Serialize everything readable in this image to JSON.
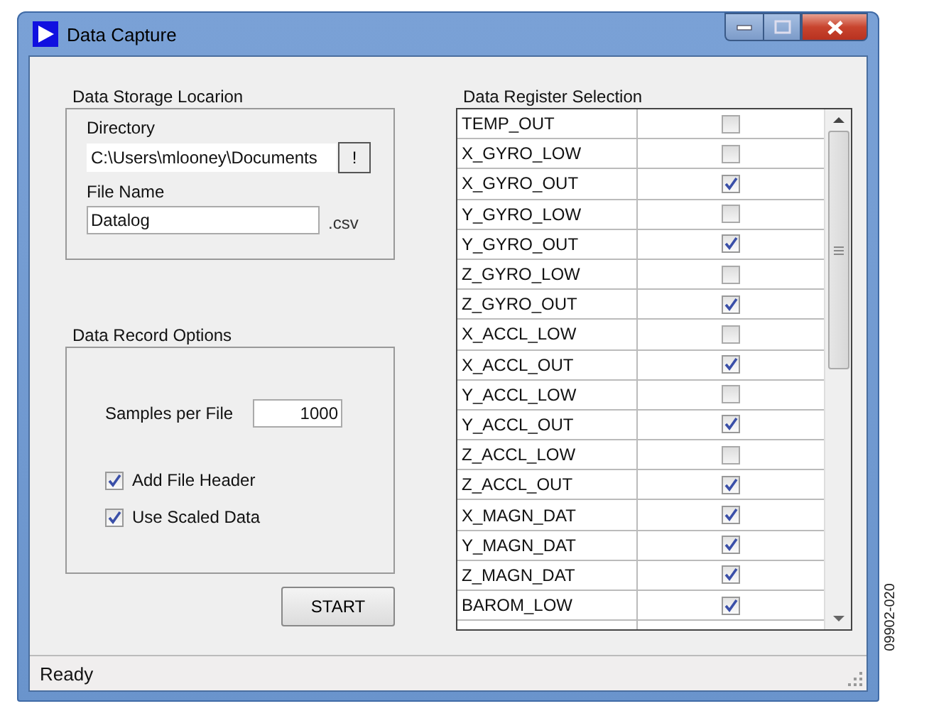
{
  "window": {
    "title": "Data Capture"
  },
  "storage": {
    "title": "Data Storage Locarion",
    "directory_label": "Directory",
    "directory": "C:\\Users\\mlooney\\Documents",
    "browse_button": "!",
    "file_name_label": "File Name",
    "file_name": "Datalog",
    "extension": ".csv"
  },
  "record_options": {
    "title": "Data Record Options",
    "samples_label": "Samples per File",
    "samples": "1000",
    "checkboxes": [
      {
        "label": "Add File Header",
        "checked": true
      },
      {
        "label": "Use Scaled Data",
        "checked": true
      }
    ]
  },
  "start_button": "START",
  "registers": {
    "title": "Data Register Selection",
    "rows": [
      {
        "name": "TEMP_OUT",
        "checked": false
      },
      {
        "name": "X_GYRO_LOW",
        "checked": false
      },
      {
        "name": "X_GYRO_OUT",
        "checked": true
      },
      {
        "name": "Y_GYRO_LOW",
        "checked": false
      },
      {
        "name": "Y_GYRO_OUT",
        "checked": true
      },
      {
        "name": "Z_GYRO_LOW",
        "checked": false
      },
      {
        "name": "Z_GYRO_OUT",
        "checked": true
      },
      {
        "name": "X_ACCL_LOW",
        "checked": false
      },
      {
        "name": "X_ACCL_OUT",
        "checked": true
      },
      {
        "name": "Y_ACCL_LOW",
        "checked": false
      },
      {
        "name": "Y_ACCL_OUT",
        "checked": true
      },
      {
        "name": "Z_ACCL_LOW",
        "checked": false
      },
      {
        "name": "Z_ACCL_OUT",
        "checked": true
      },
      {
        "name": "X_MAGN_DAT",
        "checked": true
      },
      {
        "name": "Y_MAGN_DAT",
        "checked": true
      },
      {
        "name": "Z_MAGN_DAT",
        "checked": true
      },
      {
        "name": "BAROM_LOW",
        "checked": true
      }
    ]
  },
  "status_bar": "Ready",
  "figure_id": "09902-020"
}
